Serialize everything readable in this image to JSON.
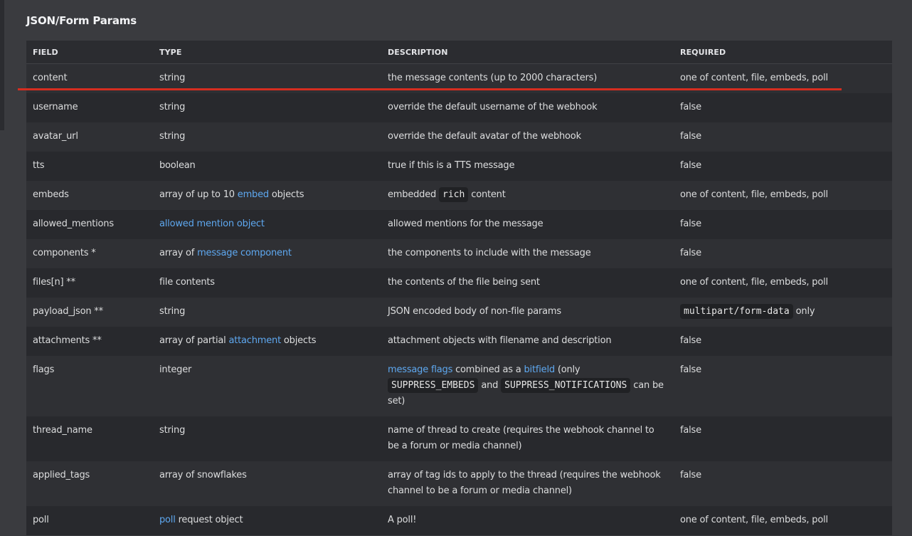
{
  "section": {
    "title": "JSON/Form Params"
  },
  "table": {
    "headers": [
      "FIELD",
      "TYPE",
      "DESCRIPTION",
      "REQUIRED"
    ],
    "rows": [
      {
        "field": "content",
        "type": [
          {
            "text": "string"
          }
        ],
        "description": [
          {
            "text": "the message contents (up to 2000 characters)"
          }
        ],
        "required": [
          {
            "text": "one of content, file, embeds, poll"
          }
        ]
      },
      {
        "field": "username",
        "type": [
          {
            "text": "string"
          }
        ],
        "description": [
          {
            "text": "override the default username of the webhook"
          }
        ],
        "required": [
          {
            "text": "false"
          }
        ]
      },
      {
        "field": "avatar_url",
        "type": [
          {
            "text": "string"
          }
        ],
        "description": [
          {
            "text": "override the default avatar of the webhook"
          }
        ],
        "required": [
          {
            "text": "false"
          }
        ]
      },
      {
        "field": "tts",
        "type": [
          {
            "text": "boolean"
          }
        ],
        "description": [
          {
            "text": "true if this is a TTS message"
          }
        ],
        "required": [
          {
            "text": "false"
          }
        ]
      },
      {
        "field": "embeds",
        "type": [
          {
            "text": "array of up to 10 "
          },
          {
            "text": "embed",
            "link": true
          },
          {
            "text": " objects"
          }
        ],
        "description": [
          {
            "text": "embedded "
          },
          {
            "text": "rich",
            "code": true
          },
          {
            "text": " content"
          }
        ],
        "required": [
          {
            "text": "one of content, file, embeds, poll"
          }
        ]
      },
      {
        "field": "allowed_mentions",
        "type": [
          {
            "text": "allowed mention object",
            "link": true
          }
        ],
        "description": [
          {
            "text": "allowed mentions for the message"
          }
        ],
        "required": [
          {
            "text": "false"
          }
        ]
      },
      {
        "field": "components *",
        "type": [
          {
            "text": "array of "
          },
          {
            "text": "message component",
            "link": true
          }
        ],
        "description": [
          {
            "text": "the components to include with the message"
          }
        ],
        "required": [
          {
            "text": "false"
          }
        ]
      },
      {
        "field": "files[n] **",
        "type": [
          {
            "text": "file contents"
          }
        ],
        "description": [
          {
            "text": "the contents of the file being sent"
          }
        ],
        "required": [
          {
            "text": "one of content, file, embeds, poll"
          }
        ]
      },
      {
        "field": "payload_json **",
        "type": [
          {
            "text": "string"
          }
        ],
        "description": [
          {
            "text": "JSON encoded body of non-file params"
          }
        ],
        "required": [
          {
            "text": "multipart/form-data",
            "code": true
          },
          {
            "text": " only"
          }
        ]
      },
      {
        "field": "attachments **",
        "type": [
          {
            "text": "array of partial "
          },
          {
            "text": "attachment",
            "link": true
          },
          {
            "text": " objects"
          }
        ],
        "description": [
          {
            "text": "attachment objects with filename and description"
          }
        ],
        "required": [
          {
            "text": "false"
          }
        ]
      },
      {
        "field": "flags",
        "type": [
          {
            "text": "integer"
          }
        ],
        "description": [
          {
            "text": "message flags",
            "link": true
          },
          {
            "text": " combined as a "
          },
          {
            "text": "bitfield",
            "link": true
          },
          {
            "text": " (only "
          },
          {
            "text": "SUPPRESS_EMBEDS",
            "code": true
          },
          {
            "text": " and "
          },
          {
            "text": "SUPPRESS_NOTIFICATIONS",
            "code": true
          },
          {
            "text": " can be set)"
          }
        ],
        "required": [
          {
            "text": "false"
          }
        ]
      },
      {
        "field": "thread_name",
        "type": [
          {
            "text": "string"
          }
        ],
        "description": [
          {
            "text": "name of thread to create (requires the webhook channel to be a forum or media channel)"
          }
        ],
        "required": [
          {
            "text": "false"
          }
        ]
      },
      {
        "field": "applied_tags",
        "type": [
          {
            "text": "array of snowflakes"
          }
        ],
        "description": [
          {
            "text": "array of tag ids to apply to the thread (requires the webhook channel to be a forum or media channel)"
          }
        ],
        "required": [
          {
            "text": "false"
          }
        ]
      },
      {
        "field": "poll",
        "type": [
          {
            "text": "poll",
            "link": true
          },
          {
            "text": " request object"
          }
        ],
        "description": [
          {
            "text": "A poll!"
          }
        ],
        "required": [
          {
            "text": "one of content, file, embeds, poll"
          }
        ]
      }
    ]
  },
  "colors": {
    "page_background": "#3a3b3f",
    "row_odd": "#2f3034",
    "row_even": "#28292d",
    "link": "#5ea8f0",
    "annotation_underline": "#d62d20"
  }
}
